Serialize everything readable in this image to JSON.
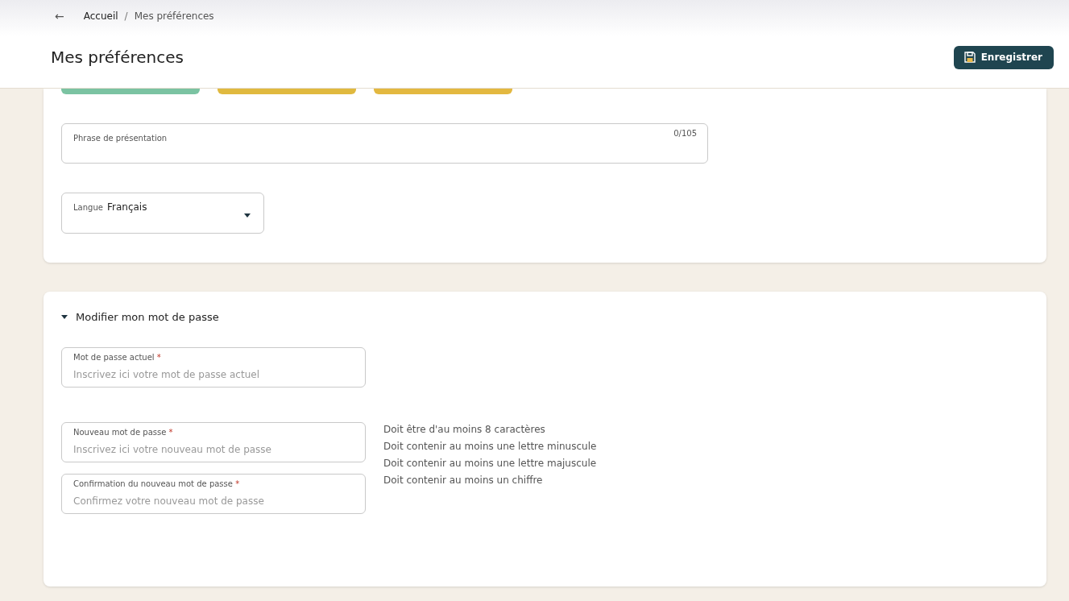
{
  "breadcrumb": {
    "back": "←",
    "items": [
      {
        "label": "Accueil",
        "current": false
      },
      {
        "label": "Mes préférences",
        "current": true
      }
    ],
    "separator": "/"
  },
  "header": {
    "title": "Mes préférences",
    "save_button": "Enregistrer"
  },
  "profile": {
    "bio_field": {
      "label": "Phrase de présentation",
      "counter": "0/105"
    },
    "language_field": {
      "label": "Langue",
      "value": "Français"
    }
  },
  "password_section": {
    "title": "Modifier mon mot de passe",
    "expanded": true,
    "required_mark": "*",
    "fields": [
      {
        "label": "Mot de passe actuel",
        "required": true,
        "placeholder": "Inscrivez ici votre mot de passe actuel"
      },
      {
        "label": "Nouveau mot de passe",
        "required": true,
        "placeholder": "Inscrivez ici votre nouveau mot de passe"
      },
      {
        "label": "Confirmation du nouveau mot de passe",
        "required": true,
        "placeholder": "Confirmez votre nouveau mot de passe"
      }
    ],
    "rules": [
      "Doit être d'au moins 8 caractères",
      "Doit contenir au moins une lettre minuscule",
      "Doit contenir au moins une lettre majuscule",
      "Doit contenir au moins un chiffre"
    ]
  }
}
